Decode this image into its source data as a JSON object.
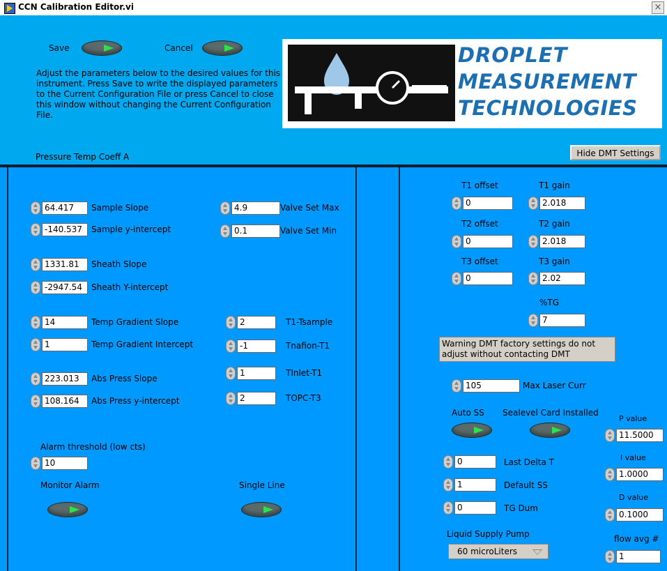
{
  "window": {
    "title": "CCN Calibration Editor.vi",
    "close": "×"
  },
  "header": {
    "save_label": "Save",
    "cancel_label": "Cancel",
    "description": "Adjust the parameters below to the desired values for this instrument.  Press Save to write the displayed parameters to the Current Configuration File or press Cancel to close this window without changing the Current Configuration File.",
    "logo": {
      "line1": "DROPLET",
      "line2": "MEASUREMENT",
      "line3": "TECHNOLOGIES"
    },
    "pressure_temp_coeff_label": "Pressure Temp Coeff A",
    "hide_dmt_button": "Hide DMT Settings"
  },
  "left": {
    "sample_slope": {
      "value": "64.417",
      "label": "Sample Slope"
    },
    "sample_yint": {
      "value": "-140.537",
      "label": "Sample y-intercept"
    },
    "sheath_slope": {
      "value": "1331.81",
      "label": "Sheath Slope"
    },
    "sheath_yint": {
      "value": "-2947.54",
      "label": "Sheath Y-intercept"
    },
    "temp_grad_slope": {
      "value": "14",
      "label": "Temp Gradient Slope"
    },
    "temp_grad_int": {
      "value": "1",
      "label": "Temp Gradient Intercept"
    },
    "abs_press_slope": {
      "value": "223.013",
      "label": "Abs Press Slope"
    },
    "abs_press_yint": {
      "value": "108.164",
      "label": "Abs Press y-intercept"
    },
    "alarm_label": "Alarm threshold (low cts)",
    "alarm_value": "10",
    "monitor_alarm_label": "Monitor Alarm",
    "single_line_label": "Single Line",
    "valve_max": {
      "value": "4.9",
      "label": "Valve Set Max"
    },
    "valve_min": {
      "value": "0.1",
      "label": "Valve Set Min"
    },
    "t1_tsample": {
      "value": "2",
      "label": "T1-Tsample"
    },
    "tnafion_t1": {
      "value": "-1",
      "label": "Tnafion-T1"
    },
    "tinlet_t1": {
      "value": "1",
      "label": "TInlet-T1"
    },
    "topc_t3": {
      "value": "2",
      "label": "TOPC-T3"
    }
  },
  "right": {
    "t1_offset": {
      "label": "T1 offset",
      "value": "0"
    },
    "t1_gain": {
      "label": "T1 gain",
      "value": "2.018"
    },
    "t2_offset": {
      "label": "T2 offset",
      "value": "0"
    },
    "t2_gain": {
      "label": "T2 gain",
      "value": "2.018"
    },
    "t3_offset": {
      "label": "T3 offset",
      "value": "0"
    },
    "t3_gain": {
      "label": "T3 gain",
      "value": "2.02"
    },
    "pct_tg": {
      "label": "%TG",
      "value": "7"
    },
    "warning": "Warning DMT factory settings do not adjust without contacting DMT",
    "max_laser": {
      "value": "105",
      "label": "Max Laser Curr"
    },
    "auto_ss_label": "Auto SS",
    "sealevel_label": "Sealevel Card Installed",
    "p_value": {
      "label": "P value",
      "value": "11.5000"
    },
    "i_value": {
      "label": "I value",
      "value": "1.0000"
    },
    "d_value": {
      "label": "D value",
      "value": "0.1000"
    },
    "last_delta_t": {
      "value": "0",
      "label": "Last Delta T"
    },
    "default_ss": {
      "value": "1",
      "label": "Default SS"
    },
    "tg_dum": {
      "value": "0",
      "label": "TG Dum"
    },
    "pump_label": "Liquid Supply Pump",
    "pump_value": "60 microLiters",
    "flow_avg": {
      "label": "flow avg #",
      "value": "1"
    }
  }
}
